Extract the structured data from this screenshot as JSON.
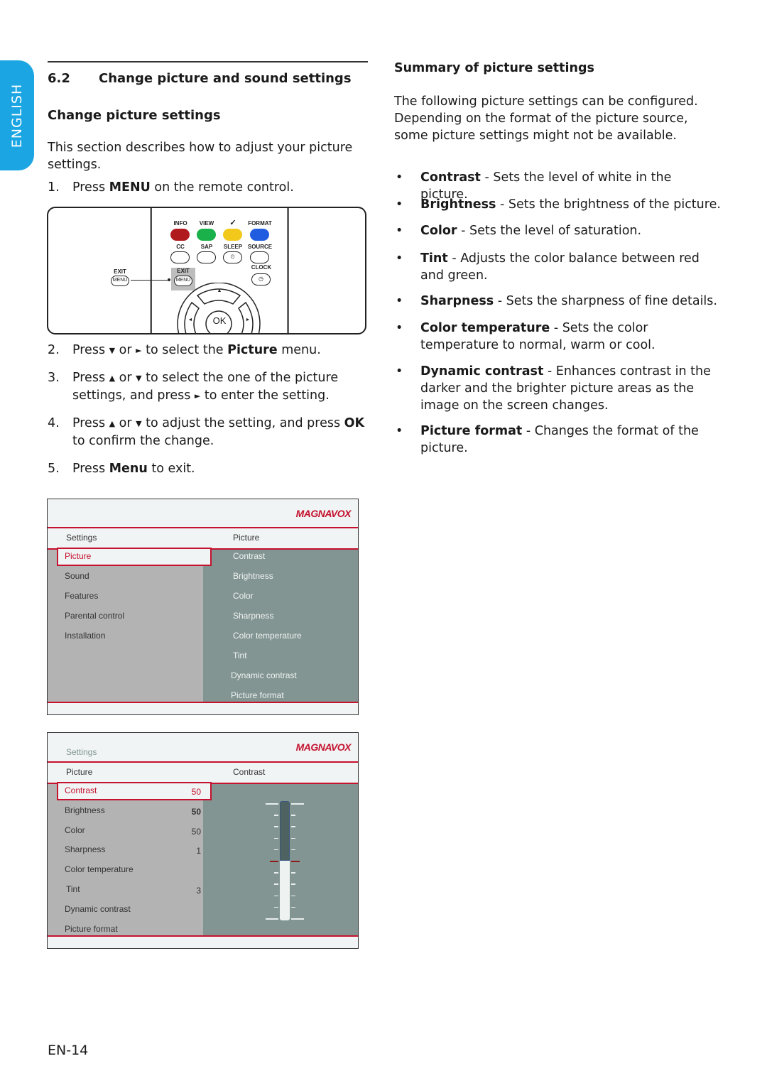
{
  "language_tab": "ENGLISH",
  "section": {
    "number": "6.2",
    "title": "Change picture and sound settings"
  },
  "subsection_title": "Change picture settings",
  "intro": "This section describes how to adjust your picture settings.",
  "steps": [
    {
      "num": "1.",
      "parts": [
        [
          "Press ",
          false
        ],
        [
          "MENU",
          true
        ],
        [
          " on the remote control.",
          false
        ]
      ]
    },
    {
      "num": "2.",
      "parts": [
        [
          "Press ",
          false
        ],
        [
          "▼",
          "tri"
        ],
        [
          " or ",
          false
        ],
        [
          "►",
          "tri"
        ],
        [
          " to select the ",
          false
        ],
        [
          "Picture",
          true
        ],
        [
          " menu.",
          false
        ]
      ]
    },
    {
      "num": "3.",
      "parts": [
        [
          "Press ",
          false
        ],
        [
          "▲",
          "tri"
        ],
        [
          " or ",
          false
        ],
        [
          "▼",
          "tri"
        ],
        [
          " to select the one of the picture settings, and press ",
          false
        ],
        [
          "►",
          "tri"
        ],
        [
          " to enter the setting.",
          false
        ]
      ]
    },
    {
      "num": "4.",
      "parts": [
        [
          "Press ",
          false
        ],
        [
          "▲",
          "tri"
        ],
        [
          " or ",
          false
        ],
        [
          "▼",
          "tri"
        ],
        [
          " to adjust the setting, and press ",
          false
        ],
        [
          "OK",
          true
        ],
        [
          " to confirm the change.",
          false
        ]
      ]
    },
    {
      "num": "5.",
      "parts": [
        [
          "Press ",
          false
        ],
        [
          "Menu",
          true
        ],
        [
          " to exit.",
          false
        ]
      ]
    }
  ],
  "remote": {
    "color_labels": [
      "INFO",
      "VIEW",
      "✓",
      "FORMAT"
    ],
    "color_buttons": [
      "#b01a1f",
      "#1ab04a",
      "#f2c81a",
      "#1f5ce0"
    ],
    "row2_labels": [
      "CC",
      "SAP",
      "SLEEP",
      "SOURCE"
    ],
    "sleep_glyph": "⏲",
    "exit_label": "EXIT",
    "menu_label": "MENU",
    "clock_label": "CLOCK",
    "clock_glyph": "◷",
    "ok_label": "OK",
    "up": "▲",
    "left": "◄",
    "right": "►"
  },
  "menu1": {
    "brand": "MAGNAVOX",
    "header_left": "Settings",
    "header_right": "Picture",
    "left_items": [
      "Picture",
      "Sound",
      "Features",
      "Parental control",
      "Installation"
    ],
    "selected_left": "Picture",
    "right_items": [
      "Contrast",
      "Brightness",
      "Color",
      "Sharpness",
      "Color temperature",
      "Tint",
      "Dynamic contrast",
      "Picture format"
    ]
  },
  "menu2": {
    "brand": "MAGNAVOX",
    "title": "Settings",
    "header_left": "Picture",
    "header_right": "Contrast",
    "items": [
      {
        "label": "Contrast",
        "value": "50"
      },
      {
        "label": "Brightness",
        "value": "50"
      },
      {
        "label": "Color",
        "value": "50"
      },
      {
        "label": "Sharpness",
        "value": "1"
      },
      {
        "label": "Color temperature",
        "value": ""
      },
      {
        "label": "Tint",
        "value": "3"
      },
      {
        "label": "Dynamic contrast",
        "value": ""
      },
      {
        "label": "Picture format",
        "value": ""
      }
    ],
    "selected": "Contrast",
    "slider_level_percent": 50
  },
  "summary": {
    "title": "Summary of picture settings",
    "intro": "The following picture settings can be configured. Depending on the format of the picture source, some picture settings might not be available.",
    "bullet_glyph": "•",
    "items": [
      {
        "term": "Contrast",
        "desc": " - Sets the level of white in the picture."
      },
      {
        "term": "Brightness",
        "desc": " - Sets the brightness of the picture."
      },
      {
        "term": "Color",
        "desc": " - Sets the level of saturation."
      },
      {
        "term": "Tint",
        "desc": " - Adjusts the color balance between red and green."
      },
      {
        "term": "Sharpness",
        "desc": " - Sets the sharpness of fine details."
      },
      {
        "term": "Color temperature",
        "desc": " - Sets the color temperature to normal, warm or cool."
      },
      {
        "term": "Dynamic contrast",
        "desc": " - Enhances contrast in the darker and the brighter picture areas as the image on the screen changes."
      },
      {
        "term": "Picture format",
        "desc": " - Changes the format of the picture."
      }
    ]
  },
  "page_number": "EN-14"
}
